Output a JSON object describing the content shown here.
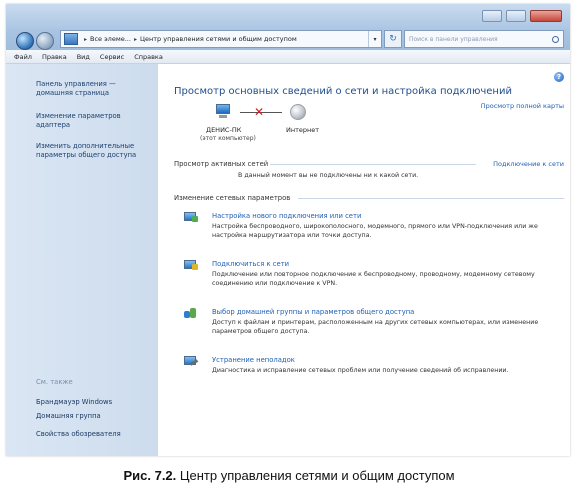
{
  "address_bar": {
    "crumbs": [
      "Все элеме...",
      "Центр управления сетями и общим доступом"
    ],
    "search_placeholder": "Поиск в панели управления"
  },
  "menu": [
    "Файл",
    "Правка",
    "Вид",
    "Сервис",
    "Справка"
  ],
  "sidebar": {
    "items": [
      "Панель управления — домашняя страница",
      "Изменение параметров адаптера",
      "Изменить дополнительные параметры общего доступа"
    ],
    "see_also_heading": "См. также",
    "see_also": [
      "Брандмауэр Windows",
      "Домашняя группа",
      "Свойства обозревателя"
    ]
  },
  "main": {
    "title": "Просмотр основных сведений о сети и настройка подключений",
    "full_map_link": "Просмотр полной карты",
    "computer_name": "ДЕНИС-ПК",
    "computer_sub": "(этот компьютер)",
    "internet_label": "Интернет",
    "active_networks_heading": "Просмотр активных сетей",
    "connect_link": "Подключение к сети",
    "no_connection": "В данный момент вы не подключены ни к какой сети.",
    "change_settings_heading": "Изменение сетевых параметров",
    "tasks": [
      {
        "title": "Настройка нового подключения или сети",
        "desc": "Настройка беспроводного, широкополосного, модемного, прямого или VPN-подключения или же настройка маршрутизатора или точки доступа."
      },
      {
        "title": "Подключиться к сети",
        "desc": "Подключение или повторное подключение к беспроводному, проводному, модемному сетевому соединению или подключение к VPN."
      },
      {
        "title": "Выбор домашней группы и параметров общего доступа",
        "desc": "Доступ к файлам и принтерам, расположенным на других сетевых компьютерах, или изменение параметров общего доступа."
      },
      {
        "title": "Устранение неполадок",
        "desc": "Диагностика и исправление сетевых проблем или получение сведений об исправлении."
      }
    ]
  },
  "caption": {
    "label": "Рис. 7.2.",
    "text": "Центр управления сетями и общим доступом"
  }
}
